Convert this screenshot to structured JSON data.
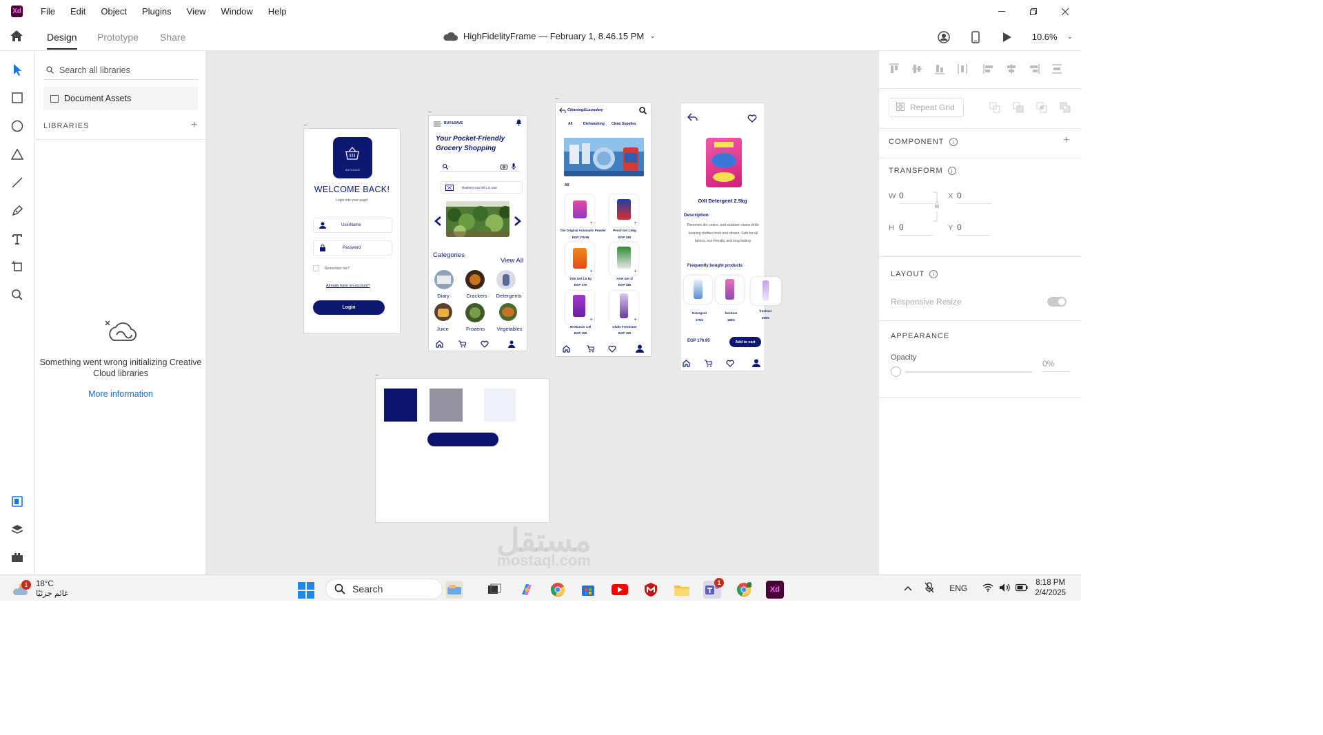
{
  "menubar": {
    "app_badge": "Xd",
    "items": [
      "File",
      "Edit",
      "Object",
      "Plugins",
      "View",
      "Window",
      "Help"
    ]
  },
  "appbar": {
    "tabs": [
      "Design",
      "Prototype",
      "Share"
    ],
    "active_tab": "Design",
    "doc_title": "HighFidelityFrame — February 1, 8.46.15 PM",
    "zoom": "10.6%"
  },
  "libraries": {
    "search_placeholder": "Search all libraries",
    "document_assets": "Document Assets",
    "heading": "LIBRARIES",
    "error": "Something went wrong initializing Creative Cloud libraries",
    "more_info": "More information"
  },
  "artboards": {
    "handle": "...",
    "login": {
      "brand": "BUY&SAVE",
      "welcome": "WELCOME BACK!",
      "subtitle": "Login into your page!",
      "username": "UserName",
      "password": "Password",
      "remember": "Remember me?",
      "account_link": "Already have an account?",
      "login_button": "Login"
    },
    "home": {
      "brand": "BUY&SAVE",
      "headline": "Your Pocket-Friendly Grocery Shopping",
      "redeem": "Redeem your 50 L.E now",
      "categories_title": "Categories",
      "view_all": "View All",
      "categories": [
        "Diary",
        "Crackers",
        "Detergents",
        "Juice",
        "Frozens",
        "Vegetables"
      ]
    },
    "listing": {
      "title": "Cleaning&Laundary",
      "tabs": [
        "All",
        "Dishwashing",
        "Clean Supplies"
      ],
      "section": "All",
      "products": [
        {
          "name": "Oxi Original Automatic Powder",
          "price": "EGP 176.95"
        },
        {
          "name": "Persil Gel 1.5kg",
          "price": "EGP 185"
        },
        {
          "name": "Tide Gel 1.5 kg",
          "price": "EGP 170"
        },
        {
          "name": "Ariel Gel 1l",
          "price": "EGP 185"
        },
        {
          "name": "Mr.Muscle 1.5l",
          "price": "EGP 150"
        },
        {
          "name": "Glade Freshener",
          "price": "EGP 190"
        }
      ]
    },
    "detail": {
      "product_name": "OXI Detergent 2.5kg",
      "description_title": "Description",
      "description": "Removes dirt, odors, and stubborn stains while keeping clothes fresh and vibrant. Safe for all fabrics, eco-friendly, and long-lasting.",
      "frequently": "Frequently bought products",
      "related": [
        {
          "name": "Detergent",
          "price": "175le"
        },
        {
          "name": "freshner",
          "price": "180le"
        },
        {
          "name": "freshner",
          "price": "200le"
        }
      ],
      "price": "EGP 176.95",
      "add_to_cart": "Add to cart"
    },
    "style_guide": {
      "colors": [
        "#0d1470",
        "#9494a0",
        "#eef0fa"
      ]
    }
  },
  "properties": {
    "repeat_grid": "Repeat Grid",
    "component": "COMPONENT",
    "transform": "TRANSFORM",
    "w_label": "W",
    "w_value": "0",
    "x_label": "X",
    "x_value": "0",
    "h_label": "H",
    "h_value": "0",
    "y_label": "Y",
    "y_value": "0",
    "layout": "LAYOUT",
    "responsive_resize": "Responsive Resize",
    "appearance": "APPEARANCE",
    "opacity_label": "Opacity",
    "opacity_value": "0%"
  },
  "taskbar": {
    "temperature": "18°C",
    "weather_text": "غائم جزئيًا",
    "weather_badge": "1",
    "search": "Search",
    "teams_badge": "1",
    "language": "ENG",
    "time": "8:18 PM",
    "date": "2/4/2025"
  },
  "watermark": {
    "arabic": "مستقل",
    "latin": "mostaql.com"
  },
  "colors": {
    "brand_navy": "#0d1870",
    "xd_purple": "#470137",
    "xd_pink": "#ff61f6",
    "link_blue": "#1473e6"
  }
}
